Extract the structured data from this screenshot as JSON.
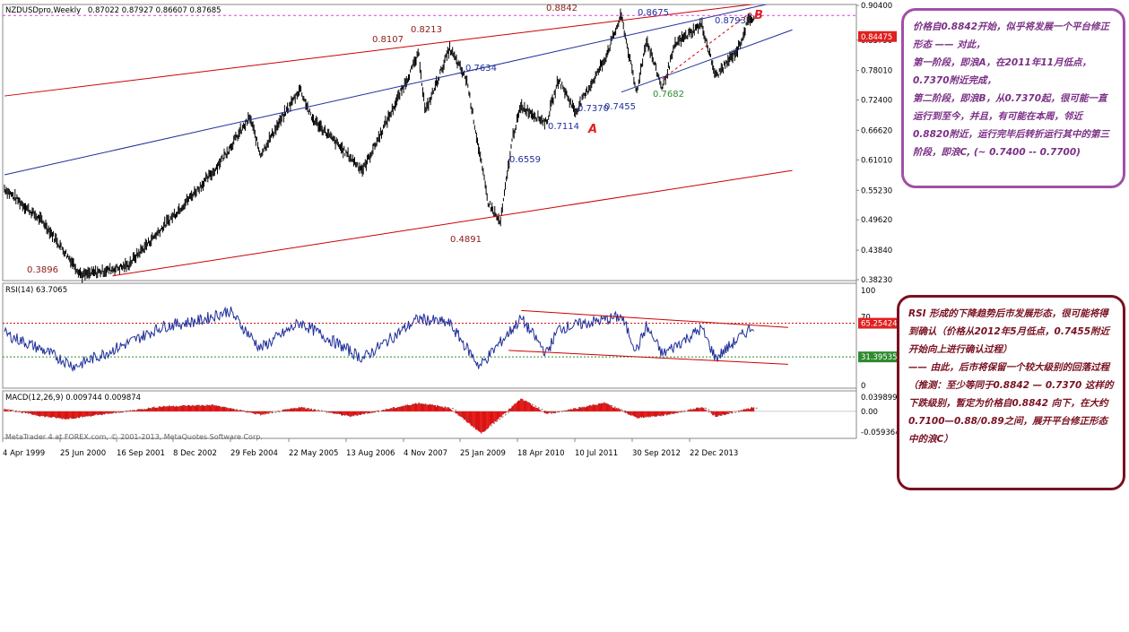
{
  "header": {
    "symbol_timeframe": "NZDUSDpro,Weekly",
    "ohlc": "0.87022 0.87927 0.86607 0.87685"
  },
  "price_axis": {
    "ticks": [
      "0.90400",
      "0.84475",
      "0.83790",
      "0.78010",
      "0.72400",
      "0.66620",
      "0.61010",
      "0.55230",
      "0.49620",
      "0.43840",
      "0.38230"
    ],
    "current_price": "0.84475"
  },
  "date_axis": {
    "labels": [
      "4 Apr 1999",
      "25 Jun 2000",
      "16 Sep 2001",
      "8 Dec 2002",
      "29 Feb 2004",
      "22 May 2005",
      "13 Aug 2006",
      "4 Nov 2007",
      "25 Jan 2009",
      "18 Apr 2010",
      "10 Jul 2011",
      "30 Sep 2012",
      "22 Dec 2013"
    ]
  },
  "price_annotations": [
    {
      "text": "0.3896",
      "color": "#8b1a1a"
    },
    {
      "text": "0.8107",
      "color": "#8b1a1a"
    },
    {
      "text": "0.8213",
      "color": "#8b1a1a"
    },
    {
      "text": "0.7634",
      "color": "#1f2f9a"
    },
    {
      "text": "0.4891",
      "color": "#8b1a1a"
    },
    {
      "text": "0.6559",
      "color": "#1f2f9a"
    },
    {
      "text": "0.7114",
      "color": "#1f2f9a"
    },
    {
      "text": "0.8842",
      "color": "#8b1a1a"
    },
    {
      "text": "0.7370",
      "color": "#1f2f9a"
    },
    {
      "text": "0.7455",
      "color": "#1f2f9a"
    },
    {
      "text": "0.8675",
      "color": "#1f2f9a"
    },
    {
      "text": "0.7682",
      "color": "#2e8b2e"
    },
    {
      "text": "0.8793",
      "color": "#1f2f9a"
    }
  ],
  "wave_labels": [
    {
      "text": "A",
      "color": "#e02020"
    },
    {
      "text": "B",
      "color": "#e02020"
    }
  ],
  "rsi_panel": {
    "title": "RSI(14) 63.7065",
    "scale_top": "100",
    "scale_70": "70",
    "scale_bottom": "0",
    "upper_level": "65.25424",
    "lower_level": "31.39535"
  },
  "macd_panel": {
    "title": "MACD(12,26,9) 0.009744 0.009874",
    "scale_top": "0.039899",
    "scale_zero": "0.00",
    "scale_bottom": "-0.059364"
  },
  "footer": "MetaTrader 4 at FOREX.com, © 2001-2013, MetaQuotes Software Corp.",
  "notes": {
    "wave_note": "价格自0.8842开始，似乎将发展一个平台修正形态 —— 对此，\n第一阶段，即浪A，在2011年11月低点，0.7370附近完成，\n第二阶段，即浪B，从0.7370起，很可能一直运行到至今，并且，有可能在本周，邻近0.8820附近，运行完毕后转折运行其中的第三阶段，即浪C, (~ 0.7400 -- 0.7700)",
    "rsi_note": "RSI 形成的下降趋势后市发展形态，很可能将得到确认（价格从2012年5月低点，0.7455附近开始向上进行确认过程）\n—— 由此，后市将保留一个较大级别的回落过程\n（推测：至少等同于0.8842 — 0.7370 这样的下跌级别，暂定为价格自0.8842 向下，在大约0.7100—0.88/0.89之间，展开平台修正形态中的浪C）"
  },
  "chart_data": [
    {
      "type": "candlestick",
      "title": "NZDUSDpro,Weekly",
      "ylim": [
        0.3823,
        0.904
      ],
      "x_range": [
        "1999-04-04",
        "2014-12-31"
      ],
      "key_points": [
        {
          "date": "1999-04-04",
          "price": 0.555
        },
        {
          "date": "2000-01-15",
          "price": 0.49
        },
        {
          "date": "2000-10-20",
          "price": 0.3896
        },
        {
          "date": "2001-09-16",
          "price": 0.408
        },
        {
          "date": "2003-06-01",
          "price": 0.585
        },
        {
          "date": "2004-02-29",
          "price": 0.69
        },
        {
          "date": "2004-05-15",
          "price": 0.62
        },
        {
          "date": "2005-03-01",
          "price": 0.7455
        },
        {
          "date": "2005-05-22",
          "price": 0.69
        },
        {
          "date": "2006-06-01",
          "price": 0.59
        },
        {
          "date": "2007-02-01",
          "price": 0.72
        },
        {
          "date": "2007-07-15",
          "price": 0.8107
        },
        {
          "date": "2007-09-01",
          "price": 0.7
        },
        {
          "date": "2008-02-25",
          "price": 0.8213
        },
        {
          "date": "2008-07-01",
          "price": 0.76
        },
        {
          "date": "2008-12-01",
          "price": 0.53
        },
        {
          "date": "2009-03-01",
          "price": 0.4891
        },
        {
          "date": "2009-06-01",
          "price": 0.6559
        },
        {
          "date": "2009-08-01",
          "price": 0.7114
        },
        {
          "date": "2010-02-01",
          "price": 0.68
        },
        {
          "date": "2010-05-01",
          "price": 0.7634
        },
        {
          "date": "2010-09-01",
          "price": 0.7
        },
        {
          "date": "2011-04-01",
          "price": 0.8
        },
        {
          "date": "2011-08-01",
          "price": 0.8842
        },
        {
          "date": "2011-11-20",
          "price": 0.737
        },
        {
          "date": "2012-02-01",
          "price": 0.8379
        },
        {
          "date": "2012-05-27",
          "price": 0.7455
        },
        {
          "date": "2012-09-01",
          "price": 0.83
        },
        {
          "date": "2013-03-10",
          "price": 0.8675
        },
        {
          "date": "2013-06-20",
          "price": 0.7682
        },
        {
          "date": "2013-12-01",
          "price": 0.82
        },
        {
          "date": "2014-02-20",
          "price": 0.8793
        },
        {
          "date": "2014-03-30",
          "price": 0.87685
        }
      ],
      "trendlines": [
        {
          "color": "#cc0000",
          "from": {
            "date": "1999-04-04",
            "price": 0.7317
          },
          "to": {
            "date": "2014-06-01",
            "price": 0.9085
          }
        },
        {
          "color": "#cc0000",
          "from": {
            "date": "2001-06-01",
            "price": 0.3896
          },
          "to": {
            "date": "2015-01-01",
            "price": 0.5901
          }
        },
        {
          "color": "#1f2f9a",
          "from": {
            "date": "1999-04-04",
            "price": 0.5818
          },
          "to": {
            "date": "2014-10-01",
            "price": 0.9116
          }
        },
        {
          "color": "#1f2f9a",
          "from": {
            "date": "2011-08-01",
            "price": 0.7389
          },
          "to": {
            "date": "2015-01-01",
            "price": 0.8575
          }
        },
        {
          "color": "#cc0000",
          "dashed": true,
          "from": {
            "date": "2012-05-27",
            "price": 0.7642
          },
          "to": {
            "date": "2014-03-01",
            "price": 0.8902
          }
        }
      ],
      "hlines": [
        {
          "price": 0.88475,
          "color": "#e040e0",
          "dashed": true
        }
      ]
    },
    {
      "type": "line",
      "title": "RSI(14) 63.7065",
      "ylim": [
        0,
        100
      ],
      "levels": [
        65.25424,
        31.39535
      ],
      "key_points": [
        {
          "date": "1999-04-04",
          "rsi": 55
        },
        {
          "date": "2000-01-15",
          "rsi": 38
        },
        {
          "date": "2000-09-01",
          "rsi": 22
        },
        {
          "date": "2001-09-16",
          "rsi": 45
        },
        {
          "date": "2002-06-01",
          "rsi": 62
        },
        {
          "date": "2003-03-01",
          "rsi": 68
        },
        {
          "date": "2003-10-01",
          "rsi": 78
        },
        {
          "date": "2004-05-15",
          "rsi": 40
        },
        {
          "date": "2005-03-01",
          "rsi": 66
        },
        {
          "date": "2006-06-01",
          "rsi": 30
        },
        {
          "date": "2007-07-15",
          "rsi": 70
        },
        {
          "date": "2008-02-25",
          "rsi": 65
        },
        {
          "date": "2008-10-01",
          "rsi": 22
        },
        {
          "date": "2009-08-01",
          "rsi": 70
        },
        {
          "date": "2010-02-01",
          "rsi": 35
        },
        {
          "date": "2010-05-01",
          "rsi": 60
        },
        {
          "date": "2011-08-01",
          "rsi": 72
        },
        {
          "date": "2011-11-20",
          "rsi": 38
        },
        {
          "date": "2012-02-01",
          "rsi": 62
        },
        {
          "date": "2012-05-27",
          "rsi": 34
        },
        {
          "date": "2013-03-10",
          "rsi": 60
        },
        {
          "date": "2013-06-20",
          "rsi": 30
        },
        {
          "date": "2014-03-30",
          "rsi": 63.7
        }
      ]
    },
    {
      "type": "histogram",
      "title": "MACD(12,26,9) 0.009744 0.009874",
      "ylim": [
        -0.059364,
        0.039899
      ],
      "key_points": [
        {
          "date": "1999-04-04",
          "macd": 0.005
        },
        {
          "date": "2000-01-15",
          "macd": -0.012
        },
        {
          "date": "2000-06-25",
          "macd": -0.018
        },
        {
          "date": "2001-06-01",
          "macd": -0.004
        },
        {
          "date": "2002-06-01",
          "macd": 0.012
        },
        {
          "date": "2003-06-01",
          "macd": 0.015
        },
        {
          "date": "2004-05-15",
          "macd": -0.008
        },
        {
          "date": "2005-03-01",
          "macd": 0.01
        },
        {
          "date": "2006-03-01",
          "macd": -0.012
        },
        {
          "date": "2007-07-15",
          "macd": 0.02
        },
        {
          "date": "2008-02-25",
          "macd": 0.008
        },
        {
          "date": "2008-10-15",
          "macd": -0.052
        },
        {
          "date": "2009-08-01",
          "macd": 0.03
        },
        {
          "date": "2010-02-01",
          "macd": -0.006
        },
        {
          "date": "2011-04-01",
          "macd": 0.02
        },
        {
          "date": "2011-11-20",
          "macd": -0.015
        },
        {
          "date": "2012-05-27",
          "macd": -0.01
        },
        {
          "date": "2013-03-10",
          "macd": 0.01
        },
        {
          "date": "2013-06-20",
          "macd": -0.012
        },
        {
          "date": "2014-03-30",
          "macd": 0.0097
        }
      ]
    }
  ]
}
